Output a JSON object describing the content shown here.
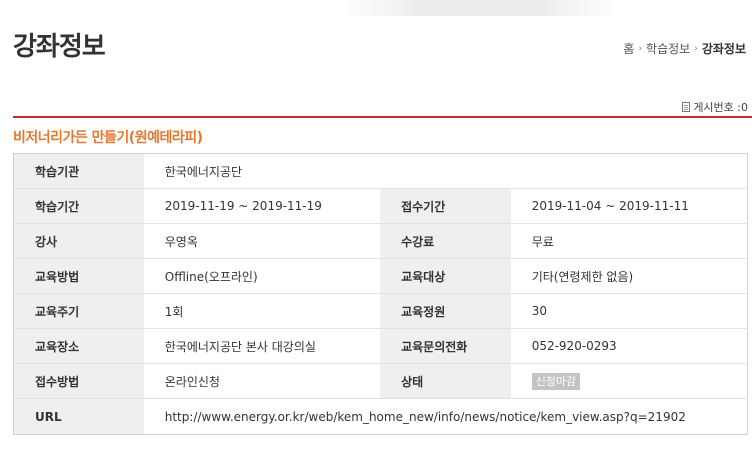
{
  "header": {
    "title": "강좌정보",
    "breadcrumb": [
      "홈",
      "학습정보",
      "강좌정보"
    ]
  },
  "views": "게시번호 :0",
  "course_title": "비저너리가든 만들기(원예테라피)",
  "info": {
    "institution_label": "학습기관",
    "institution_value": "한국에너지공단",
    "period_label": "학습기간",
    "period_value": "2019-11-19 ~ 2019-11-19",
    "apply_period_label": "접수기간",
    "apply_period_value": "2019-11-04 ~ 2019-11-11",
    "instructor_label": "강사",
    "instructor_value": "우영옥",
    "fee_label": "수강료",
    "fee_value": "무료",
    "method_label": "교육방법",
    "method_value": "Offline(오프라인)",
    "target_label": "교육대상",
    "target_value": "기타(연령제한 없음)",
    "cycle_label": "교육주기",
    "cycle_value": "1회",
    "capacity_label": "교육정원",
    "capacity_value": "30",
    "place_label": "교육장소",
    "place_value": "한국에너지공단 본사 대강의실",
    "phone_label": "교육문의전화",
    "phone_value": "052-920-0293",
    "apply_method_label": "접수방법",
    "apply_method_value": "온라인신청",
    "status_label": "상태",
    "status_value": "신청마감",
    "url_label": "URL",
    "url_value": "http://www.energy.or.kr/web/kem_home_new/info/news/notice/kem_view.asp?q=21902"
  },
  "colors": {
    "accent_line": "#b8312f",
    "course_title": "#e8772e",
    "label_bg": "#efefef",
    "status_badge": "#c3c3c3"
  }
}
